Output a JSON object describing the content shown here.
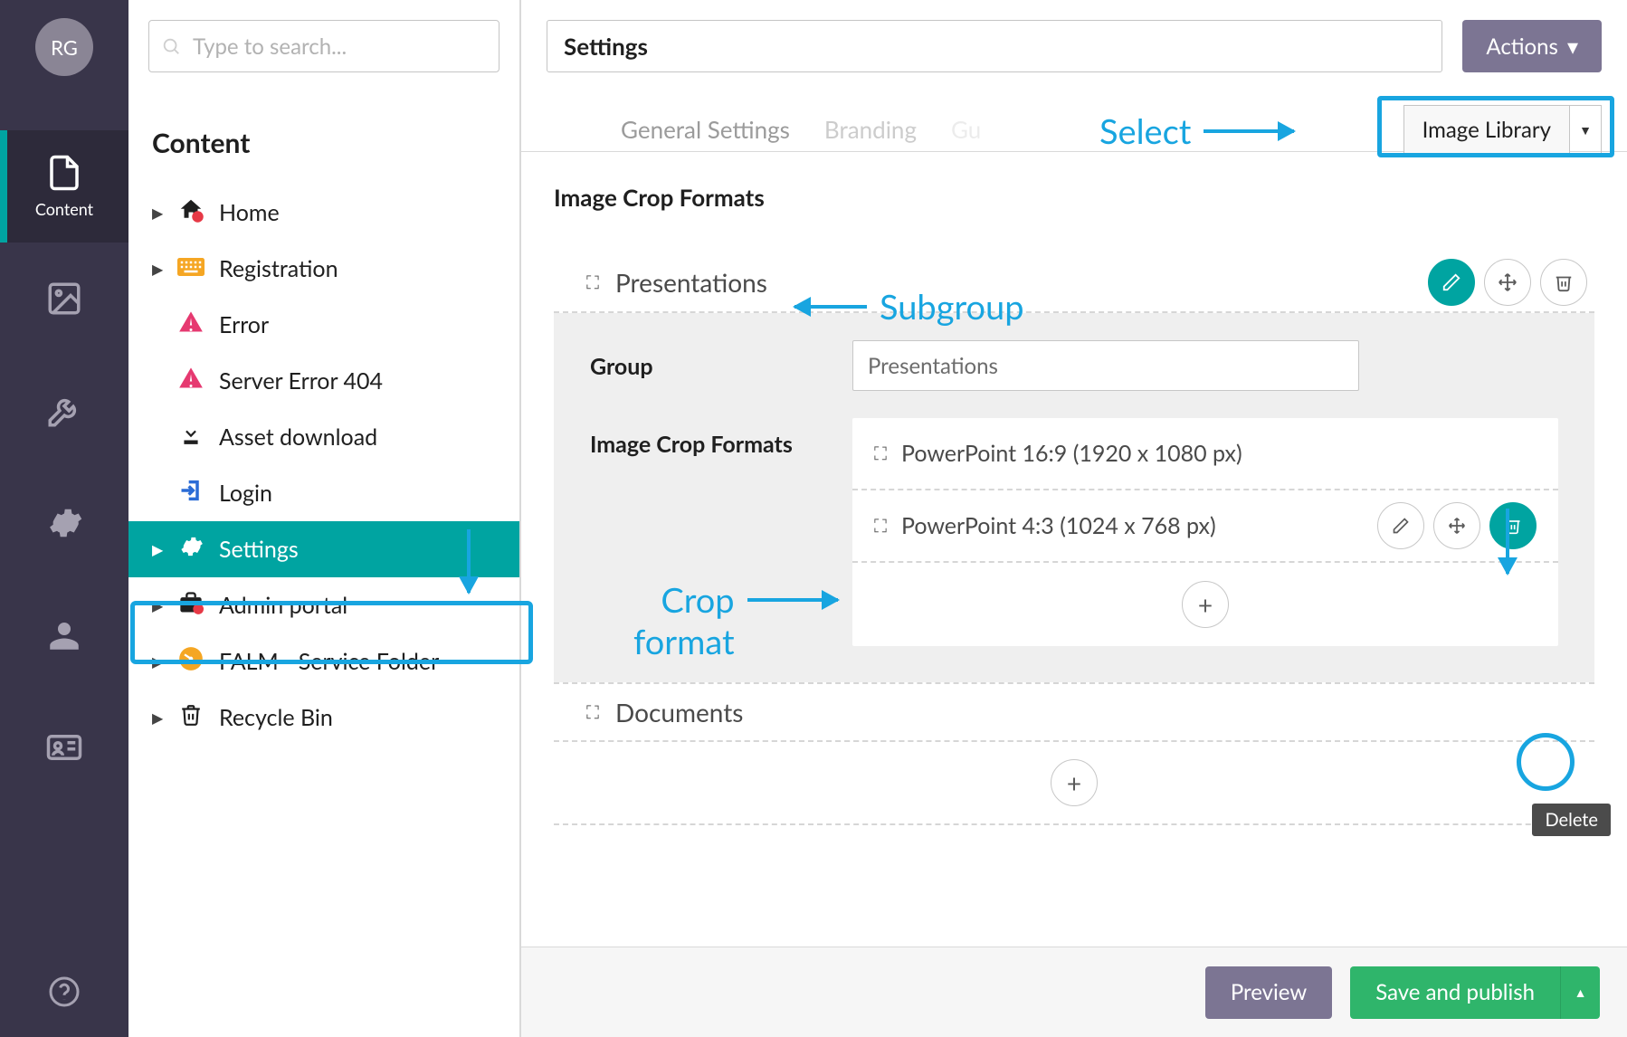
{
  "avatar_initials": "RG",
  "search": {
    "placeholder": "Type to search..."
  },
  "rail": {
    "content_label": "Content"
  },
  "tree": {
    "heading": "Content",
    "items": [
      {
        "label": "Home"
      },
      {
        "label": "Registration"
      },
      {
        "label": "Error"
      },
      {
        "label": "Server Error 404"
      },
      {
        "label": "Asset download"
      },
      {
        "label": "Login"
      },
      {
        "label": "Settings"
      },
      {
        "label": "Admin portal"
      },
      {
        "label": "FALM - Service Folder"
      },
      {
        "label": "Recycle Bin"
      }
    ]
  },
  "editor": {
    "title": "Settings",
    "actions_label": "Actions",
    "tabs": {
      "general": "General Settings",
      "branding": "Branding"
    },
    "tab_dropdown": "Image Library",
    "section_title": "Image Crop Formats",
    "group_presentations": {
      "name": "Presentations",
      "group_field_label": "Group",
      "group_field_value": "Presentations",
      "crop_field_label": "Image Crop Formats",
      "crop1": "PowerPoint 16:9 (1920 x 1080 px)",
      "crop2": "PowerPoint 4:3 (1024 x 768 px)"
    },
    "group_documents": {
      "name": "Documents"
    },
    "delete_tooltip": "Delete"
  },
  "footer": {
    "preview": "Preview",
    "save": "Save and publish"
  },
  "annotations": {
    "select": "Select",
    "subgroup": "Subgroup",
    "cropformat_l1": "Crop",
    "cropformat_l2": "format"
  }
}
